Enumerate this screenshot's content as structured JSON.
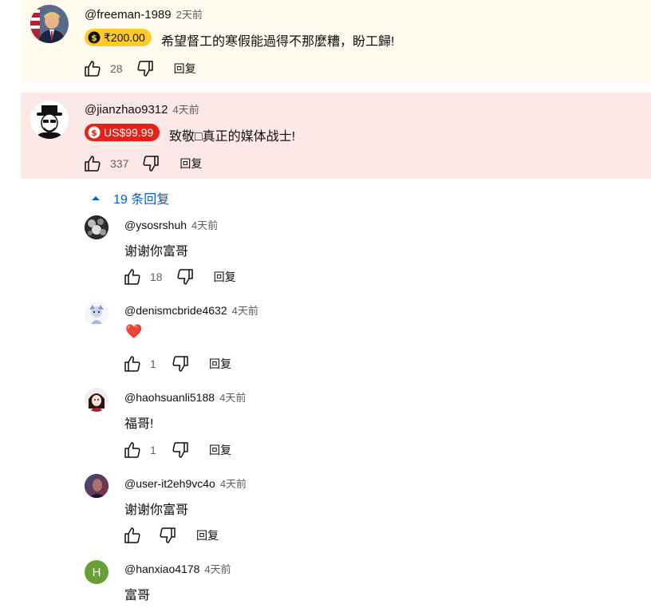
{
  "comments": [
    {
      "author": "@freeman-1989",
      "time": "2天前",
      "superchat": "₹200.00",
      "text": "希望督工的寒假能過得不那麼糟，盼工歸!",
      "likes": "28",
      "reply_label": "回复"
    },
    {
      "author": "@jianzhao9312",
      "time": "4天前",
      "superchat": "US$99.99",
      "text": "致敬□真正的媒体战士!",
      "likes": "337",
      "reply_label": "回复"
    }
  ],
  "replies_toggle": "19 条回复",
  "replies": [
    {
      "author": "@ysosrshuh",
      "time": "4天前",
      "text": "谢谢你富哥",
      "likes": "18",
      "reply_label": "回复"
    },
    {
      "author": "@denismcbride4632",
      "time": "4天前",
      "text": "❤️",
      "likes": "1",
      "reply_label": "回复"
    },
    {
      "author": "@haohsuanli5188",
      "time": "4天前",
      "text": "福哥!",
      "likes": "1",
      "reply_label": "回复"
    },
    {
      "author": "@user-it2eh9vc4o",
      "time": "4天前",
      "text": "谢谢你富哥",
      "likes": "",
      "reply_label": "回复"
    },
    {
      "author": "@hanxiao4178",
      "time": "4天前",
      "text": "富哥",
      "avatar_letter": "H",
      "likes": "",
      "reply_label": "回复"
    }
  ],
  "colors": {
    "superchat_yellow_bg": "#fffbee",
    "superchat_red_bg": "#fde8e8",
    "chip_yellow": "#ffca28",
    "chip_red": "#e62117",
    "link_blue": "#065fd4"
  }
}
